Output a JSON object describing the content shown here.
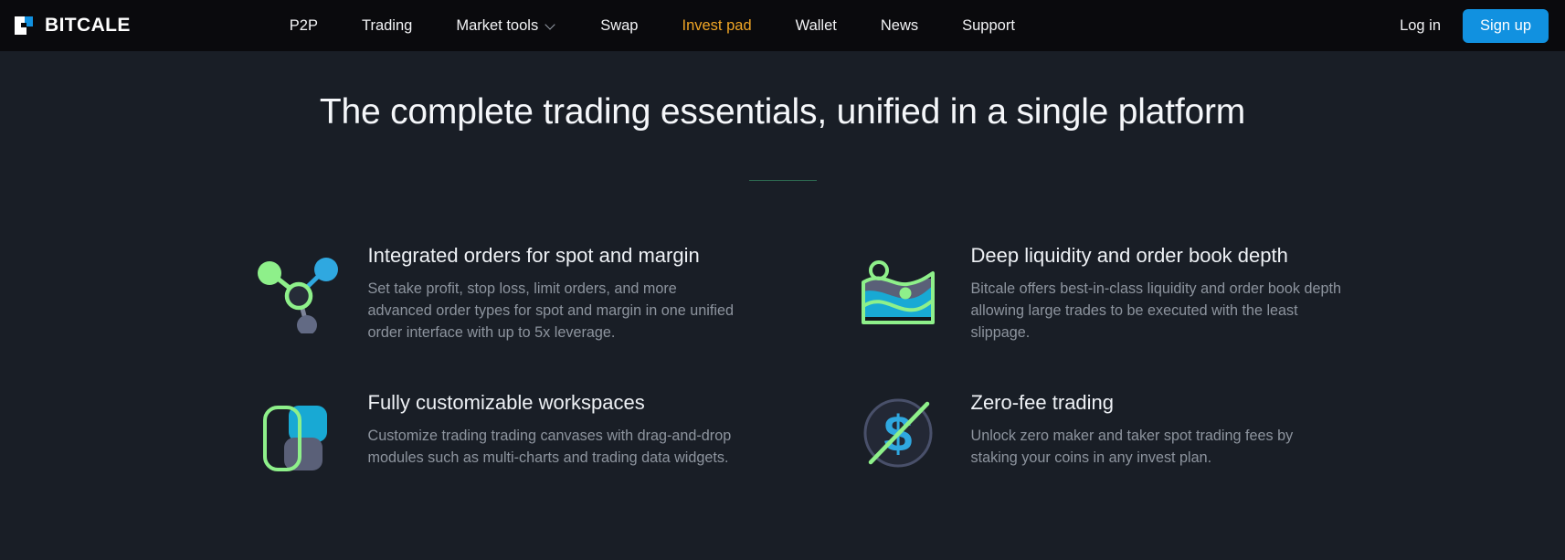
{
  "brand": {
    "name": "BITCALE",
    "logo_icon": "bitcale-logo-icon",
    "colors": {
      "mark_white": "#ffffff",
      "mark_blue": "#1191e0"
    }
  },
  "nav": {
    "items": [
      {
        "label": "P2P",
        "active": false,
        "has_dropdown": false
      },
      {
        "label": "Trading",
        "active": false,
        "has_dropdown": false
      },
      {
        "label": "Market tools",
        "active": false,
        "has_dropdown": true
      },
      {
        "label": "Swap",
        "active": false,
        "has_dropdown": false
      },
      {
        "label": "Invest pad",
        "active": true,
        "has_dropdown": false
      },
      {
        "label": "Wallet",
        "active": false,
        "has_dropdown": false
      },
      {
        "label": "News",
        "active": false,
        "has_dropdown": false
      },
      {
        "label": "Support",
        "active": false,
        "has_dropdown": false
      }
    ],
    "login_label": "Log in",
    "signup_label": "Sign up",
    "accent_active": "#f0a626",
    "accent_button": "#1191e0"
  },
  "hero": {
    "title": "The complete trading essentials, unified in a single platform",
    "rule_color": "#2e6b52"
  },
  "features": [
    {
      "icon": "network-nodes-icon",
      "title": "Integrated orders for spot and margin",
      "desc": "Set take profit, stop loss, limit orders, and more advanced order types for spot and margin in one unified order interface with up to 5x leverage."
    },
    {
      "icon": "liquidity-waves-icon",
      "title": "Deep liquidity and order book depth",
      "desc": "Bitcale offers best-in-class liquidity and order book depth allowing large trades to be executed with the least slippage."
    },
    {
      "icon": "workspace-modules-icon",
      "title": "Fully customizable workspaces",
      "desc": "Customize trading trading canvases with drag-and-drop modules such as multi-charts and trading data widgets."
    },
    {
      "icon": "zero-fee-dollar-icon",
      "title": "Zero-fee trading",
      "desc": "Unlock zero maker and taker spot trading fees by staking your coins in any invest plan."
    }
  ],
  "theme": {
    "page_bg": "#191e26",
    "nav_bg": "#0a0a0d",
    "text_primary": "#f2f3f5",
    "text_muted": "#8d949e",
    "green": "#8ef08a",
    "cyan": "#18a9d4",
    "slate": "#5a6078"
  }
}
